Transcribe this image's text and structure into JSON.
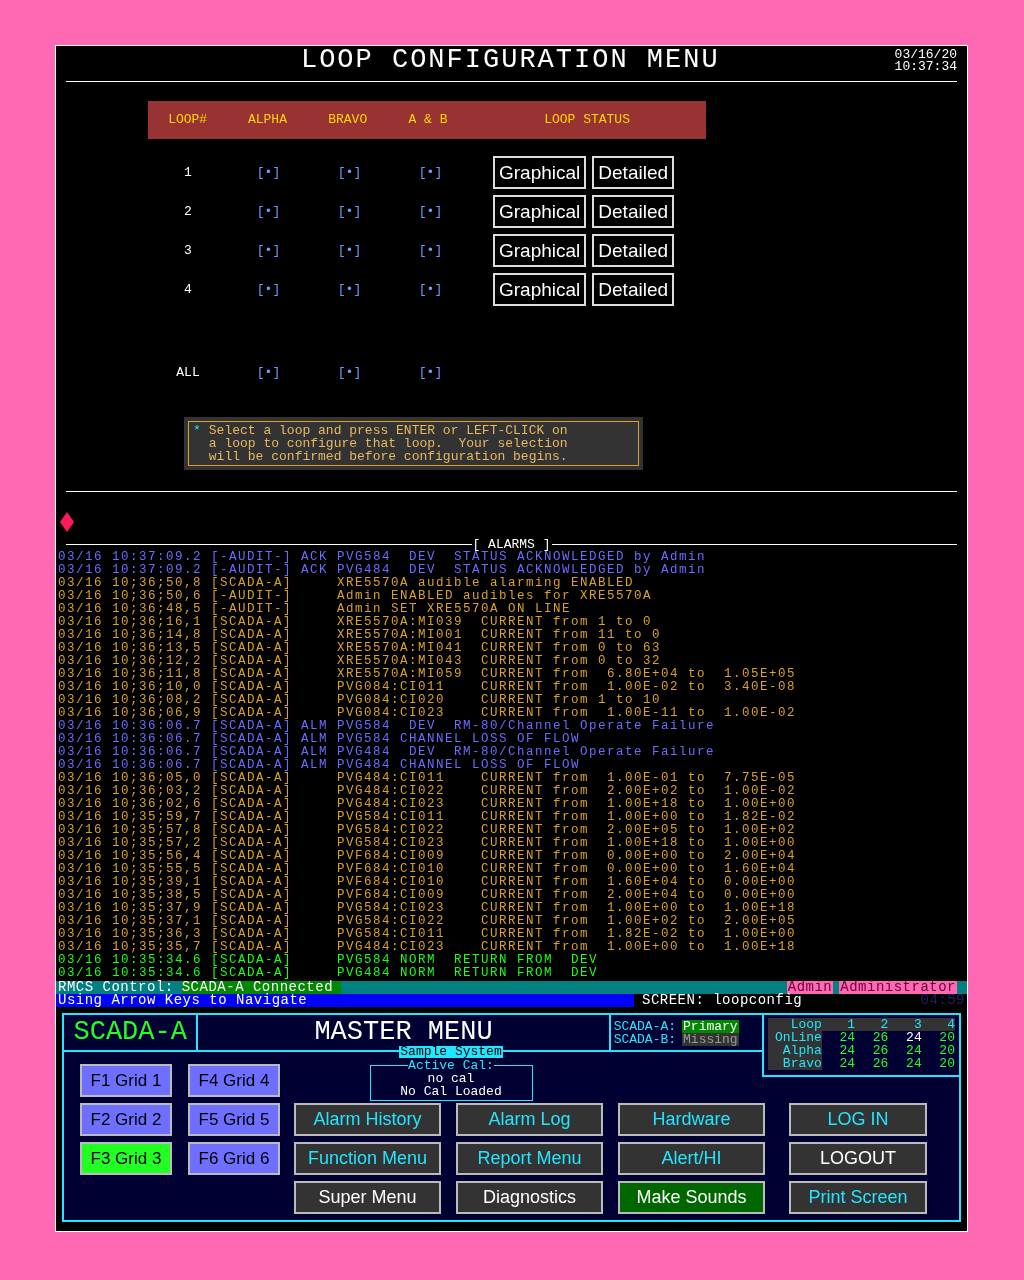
{
  "header": {
    "title": "LOOP CONFIGURATION MENU",
    "date": "03/16/20",
    "time": "10:37:34"
  },
  "loop_table": {
    "columns": [
      "LOOP#",
      "ALPHA",
      "BRAVO",
      "A & B",
      "LOOP STATUS"
    ],
    "rows": [
      {
        "loop": "1",
        "alpha": "[•]",
        "bravo": "[•]",
        "both": "[•]",
        "buttons": [
          "Graphical",
          "Detailed"
        ]
      },
      {
        "loop": "2",
        "alpha": "[•]",
        "bravo": "[•]",
        "both": "[•]",
        "buttons": [
          "Graphical",
          "Detailed"
        ]
      },
      {
        "loop": "3",
        "alpha": "[•]",
        "bravo": "[•]",
        "both": "[•]",
        "buttons": [
          "Graphical",
          "Detailed"
        ]
      },
      {
        "loop": "4",
        "alpha": "[•]",
        "bravo": "[•]",
        "both": "[•]",
        "buttons": [
          "Graphical",
          "Detailed"
        ]
      },
      {
        "loop": "ALL",
        "alpha": "[•]",
        "bravo": "[•]",
        "both": "[•]"
      }
    ]
  },
  "note": {
    "marker": "*",
    "text": "Select a loop and press ENTER or LEFT-CLICK on\na loop to configure that loop.  Your selection\nwill be confirmed before configuration begins."
  },
  "alarms": {
    "title": "[ ALARMS ]",
    "rows": [
      {
        "kind": "ack",
        "text": "03/16 10:37:09.2 [-AUDIT-] ACK PVG584  DEV  STATUS ACKNOWLEDGED by Admin"
      },
      {
        "kind": "ack",
        "text": "03/16 10:37:09.2 [-AUDIT-] ACK PVG484  DEV  STATUS ACKNOWLEDGED by Admin"
      },
      {
        "kind": "event",
        "text": "03/16 10;36;50,8 [SCADA-A]     XRE5570A audible alarming ENABLED"
      },
      {
        "kind": "event",
        "text": "03/16 10;36;50,6 [-AUDIT-]     Admin ENABLED audibles for XRE5570A"
      },
      {
        "kind": "event",
        "text": "03/16 10;36;48,5 [-AUDIT-]     Admin SET XRE5570A ON LINE"
      },
      {
        "kind": "event",
        "text": "03/16 10;36;16,1 [SCADA-A]     XRE5570A:MI039  CURRENT from 1 to 0"
      },
      {
        "kind": "event",
        "text": "03/16 10;36;14,8 [SCADA-A]     XRE5570A:MI001  CURRENT from 11 to 0"
      },
      {
        "kind": "event",
        "text": "03/16 10;36;13,5 [SCADA-A]     XRE5570A:MI041  CURRENT from 0 to 63"
      },
      {
        "kind": "event",
        "text": "03/16 10;36;12,2 [SCADA-A]     XRE5570A:MI043  CURRENT from 0 to 32"
      },
      {
        "kind": "event",
        "text": "03/16 10;36;11,8 [SCADA-A]     XRE5570A:MI059  CURRENT from  6.80E+04 to  1.05E+05"
      },
      {
        "kind": "event",
        "text": "03/16 10;36;10,0 [SCADA-A]     PVG084:CI011    CURRENT from  1.00E-02 to  3.40E-08"
      },
      {
        "kind": "event",
        "text": "03/16 10;36;08,2 [SCADA-A]     PVG084:CI020    CURRENT from 1 to 10"
      },
      {
        "kind": "event",
        "text": "03/16 10;36;06,9 [SCADA-A]     PVG084:CI023    CURRENT from  1.00E-11 to  1.00E-02"
      },
      {
        "kind": "alarm",
        "text": "03/16 10:36:06.7 [SCADA-A] ALM PVG584  DEV  RM-80/Channel Operate Failure"
      },
      {
        "kind": "alarm",
        "text": "03/16 10:36:06.7 [SCADA-A] ALM PVG584 CHANNEL LOSS OF FLOW"
      },
      {
        "kind": "alarm",
        "text": "03/16 10:36:06.7 [SCADA-A] ALM PVG484  DEV  RM-80/Channel Operate Failure"
      },
      {
        "kind": "alarm",
        "text": "03/16 10:36:06.7 [SCADA-A] ALM PVG484 CHANNEL LOSS OF FLOW"
      },
      {
        "kind": "event",
        "text": "03/16 10;36;05,0 [SCADA-A]     PVG484:CI011    CURRENT from  1.00E-01 to  7.75E-05"
      },
      {
        "kind": "event",
        "text": "03/16 10;36;03,2 [SCADA-A]     PVG484:CI022    CURRENT from  2.00E+02 to  1.00E-02"
      },
      {
        "kind": "event",
        "text": "03/16 10;36;02,6 [SCADA-A]     PVG484:CI023    CURRENT from  1.00E+18 to  1.00E+00"
      },
      {
        "kind": "event",
        "text": "03/16 10;35;59,7 [SCADA-A]     PVG584:CI011    CURRENT from  1.00E+00 to  1.82E-02"
      },
      {
        "kind": "event",
        "text": "03/16 10;35;57,8 [SCADA-A]     PVG584:CI022    CURRENT from  2.00E+05 to  1.00E+02"
      },
      {
        "kind": "event",
        "text": "03/16 10;35;57,2 [SCADA-A]     PVG584:CI023    CURRENT from  1.00E+18 to  1.00E+00"
      },
      {
        "kind": "event",
        "text": "03/16 10;35;56,4 [SCADA-A]     PVF684:CI009    CURRENT from  0.00E+00 to  2.00E+04"
      },
      {
        "kind": "event",
        "text": "03/16 10;35;55,5 [SCADA-A]     PVF684:CI010    CURRENT from  0.00E+00 to  1.60E+04"
      },
      {
        "kind": "event",
        "text": "03/16 10;35;39,1 [SCADA-A]     PVF684:CI010    CURRENT from  1.60E+04 to  0.00E+00"
      },
      {
        "kind": "event",
        "text": "03/16 10;35;38,5 [SCADA-A]     PVF684:CI009    CURRENT from  2.00E+04 to  0.00E+00"
      },
      {
        "kind": "event",
        "text": "03/16 10;35;37,9 [SCADA-A]     PVG584:CI023    CURRENT from  1.00E+00 to  1.00E+18"
      },
      {
        "kind": "event",
        "text": "03/16 10;35;37,1 [SCADA-A]     PVG584:CI022    CURRENT from  1.00E+02 to  2.00E+05"
      },
      {
        "kind": "event",
        "text": "03/16 10;35;36,3 [SCADA-A]     PVG584:CI011    CURRENT from  1.82E-02 to  1.00E+00"
      },
      {
        "kind": "event",
        "text": "03/16 10;35;35,7 [SCADA-A]     PVG484:CI023    CURRENT from  1.00E+00 to  1.00E+18"
      },
      {
        "kind": "normal",
        "text": "03/16 10:35:34.6 [SCADA-A]     PVG584 NORM  RETURN FROM  DEV"
      },
      {
        "kind": "normal",
        "text": "03/16 10:35:34.6 [SCADA-A]     PVG484 NORM  RETURN FROM  DEV"
      }
    ]
  },
  "status_bar": {
    "control_label": "RMCS Control:",
    "control_value": "SCADA-A Connected",
    "user": "Admin",
    "role": "Administrator",
    "hint": "Using Arrow Keys to Navigate",
    "screen": "SCREEN: loopconfig",
    "timer": "04:59"
  },
  "master_menu": {
    "site": "SCADA-A",
    "title": "MASTER MENU",
    "servers": [
      {
        "label": "SCADA-A:",
        "value": "Primary",
        "online": true
      },
      {
        "label": "SCADA-B:",
        "value": "Missing",
        "online": false
      }
    ],
    "loop_counts": {
      "corner": "Loop",
      "columns": [
        "1",
        "2",
        "3",
        "4"
      ],
      "rows": [
        {
          "label": "OnLine",
          "cells": [
            {
              "value": "24",
              "flagged": false
            },
            {
              "value": "26",
              "flagged": false
            },
            {
              "value": "24",
              "flagged": true
            },
            {
              "value": "20",
              "flagged": false
            }
          ]
        },
        {
          "label": "Alpha",
          "cells": [
            {
              "value": "24",
              "flagged": false
            },
            {
              "value": "26",
              "flagged": false
            },
            {
              "value": "24",
              "flagged": false
            },
            {
              "value": "20",
              "flagged": false
            }
          ]
        },
        {
          "label": "Bravo",
          "cells": [
            {
              "value": "24",
              "flagged": false
            },
            {
              "value": "26",
              "flagged": false
            },
            {
              "value": "24",
              "flagged": false
            },
            {
              "value": "20",
              "flagged": false
            }
          ]
        }
      ]
    },
    "system": "Sample System",
    "cal": {
      "legend": "Active Cal:",
      "value": "no cal",
      "status": "No Cal Loaded"
    },
    "grids": [
      {
        "label": "F1 Grid 1",
        "selected": false
      },
      {
        "label": "F4 Grid 4",
        "selected": false
      },
      {
        "label": "F2 Grid 2",
        "selected": false
      },
      {
        "label": "F5 Grid 5",
        "selected": false
      },
      {
        "label": "F3 Grid 3",
        "selected": true
      },
      {
        "label": "F6 Grid 6",
        "selected": false
      }
    ],
    "buttons": [
      {
        "label": "Alarm History",
        "kind": "link"
      },
      {
        "label": "Alarm Log",
        "kind": "link"
      },
      {
        "label": "Hardware",
        "kind": "link"
      },
      {
        "label": "LOG IN",
        "kind": "link"
      },
      {
        "label": "Function Menu",
        "kind": "link"
      },
      {
        "label": "Report Menu",
        "kind": "link"
      },
      {
        "label": "Alert/HI",
        "kind": "link"
      },
      {
        "label": "LOGOUT",
        "kind": "plain"
      },
      {
        "label": "Super Menu",
        "kind": "plain"
      },
      {
        "label": "Diagnostics",
        "kind": "plain"
      },
      {
        "label": "Make Sounds",
        "kind": "active"
      },
      {
        "label": "Print Screen",
        "kind": "link"
      }
    ]
  }
}
